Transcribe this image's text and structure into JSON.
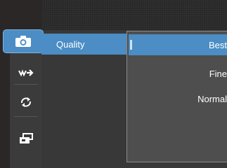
{
  "menu": {
    "setting_label": "Quality",
    "tabs": [
      {
        "icon": "camera-icon",
        "active": true
      },
      {
        "icon": "scene-mode-icon",
        "active": false
      },
      {
        "icon": "refresh-icon",
        "active": false
      },
      {
        "icon": "settings-card-icon",
        "active": false
      }
    ]
  },
  "dropdown": {
    "options": [
      "Best",
      "Fine",
      "Normal"
    ],
    "selected": "Best"
  },
  "colors": {
    "accent": "#4b8dc4",
    "panel": "#383838",
    "dropdown": "#4e4e4e"
  }
}
